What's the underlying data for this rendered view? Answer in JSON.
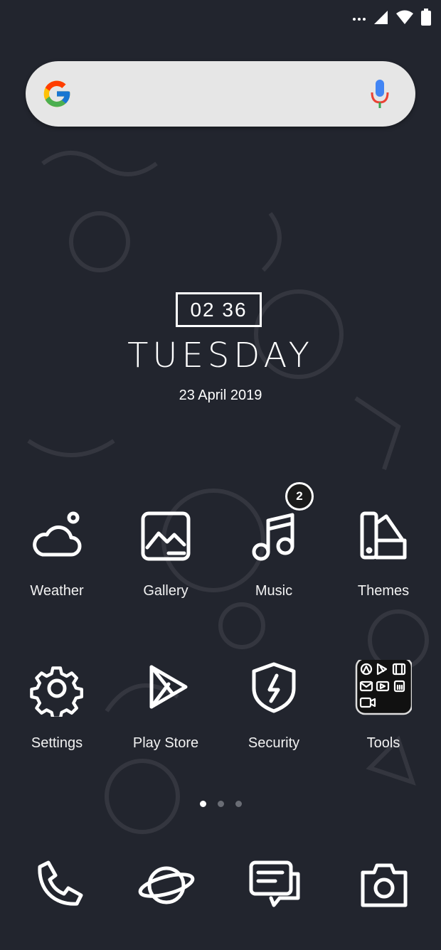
{
  "status_bar": {
    "icons": [
      "more-dots-icon",
      "signal-icon",
      "wifi-icon",
      "battery-icon"
    ]
  },
  "search": {
    "icons": [
      "google-logo-icon",
      "microphone-icon"
    ]
  },
  "clock": {
    "time": "02 36",
    "day": "TUESDAY",
    "date": "23 April 2019"
  },
  "apps_row1": [
    {
      "label": "Weather",
      "icon": "weather-icon"
    },
    {
      "label": "Gallery",
      "icon": "gallery-icon"
    },
    {
      "label": "Music",
      "icon": "music-icon",
      "badge": "2"
    },
    {
      "label": "Themes",
      "icon": "themes-icon"
    }
  ],
  "apps_row2": [
    {
      "label": "Settings",
      "icon": "settings-icon"
    },
    {
      "label": "Play Store",
      "icon": "play-store-icon"
    },
    {
      "label": "Security",
      "icon": "security-icon"
    },
    {
      "label": "Tools",
      "icon": "tools-folder-icon"
    }
  ],
  "page_indicator": {
    "pages": 3,
    "active": 1
  },
  "dock": [
    "phone-icon",
    "browser-icon",
    "messages-icon",
    "camera-icon"
  ],
  "colors": {
    "background": "#22252e",
    "icon": "#ffffff",
    "search_bg": "#e6e6e6"
  }
}
